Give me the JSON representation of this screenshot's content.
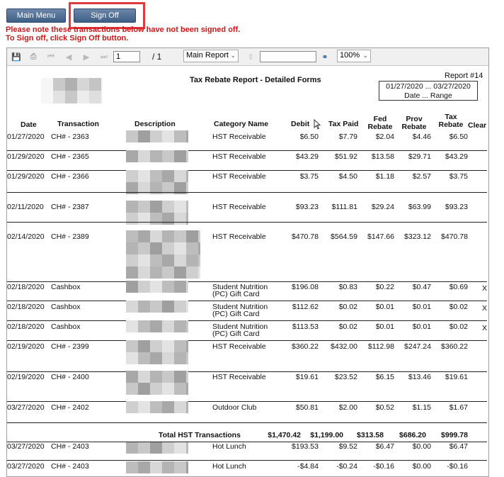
{
  "buttons": {
    "main_menu": "Main Menu",
    "sign_off": "Sign Off"
  },
  "notice": {
    "line1": "Please note these transactions below have not been signed off.",
    "line2": "To Sign off, click Sign Off button."
  },
  "toolbar": {
    "page_current": "1",
    "page_total": "/ 1",
    "report_select": "Main Report",
    "search_value": "",
    "zoom": "100%"
  },
  "report": {
    "title": "Tax Rebate Report - Detailed Forms",
    "report_no": "Report #14",
    "date_range": "01/27/2020 ... 03/27/2020",
    "date_range_label": "Date ... Range",
    "headers": {
      "date": "Date",
      "transaction": "Transaction",
      "description": "Description",
      "category": "Category Name",
      "debit": "Debit",
      "tax_paid": "Tax Paid",
      "fed_rebate": "Fed Rebate",
      "prov_rebate": "Prov Rebate",
      "tax_rebate": "Tax Rebate",
      "clear": "Clear"
    },
    "rows": [
      {
        "date": "01/27/2020",
        "txn": "CH# - 2363",
        "cat": "HST Receivable",
        "cat2": "",
        "debit": "$6.50",
        "tax_paid": "$7.79",
        "fed": "$2.04",
        "prov": "$4.46",
        "rebate": "$6.50",
        "clear": ""
      },
      {
        "date": "01/29/2020",
        "txn": "CH# - 2365",
        "cat": "HST Receivable",
        "cat2": "",
        "debit": "$43.29",
        "tax_paid": "$51.92",
        "fed": "$13.58",
        "prov": "$29.71",
        "rebate": "$43.29",
        "clear": ""
      },
      {
        "date": "01/29/2020",
        "txn": "CH# - 2366",
        "cat": "HST Receivable",
        "cat2": "",
        "debit": "$3.75",
        "tax_paid": "$4.50",
        "fed": "$1.18",
        "prov": "$2.57",
        "rebate": "$3.75",
        "clear": ""
      },
      {
        "date": "02/11/2020",
        "txn": "CH# - 2387",
        "cat": "HST Receivable",
        "cat2": "",
        "debit": "$93.23",
        "tax_paid": "$111.81",
        "fed": "$29.24",
        "prov": "$63.99",
        "rebate": "$93.23",
        "clear": ""
      },
      {
        "date": "02/14/2020",
        "txn": "CH# - 2389",
        "cat": "HST Receivable",
        "cat2": "",
        "debit": "$470.78",
        "tax_paid": "$564.59",
        "fed": "$147.66",
        "prov": "$323.12",
        "rebate": "$470.78",
        "clear": ""
      },
      {
        "date": "02/18/2020",
        "txn": "Cashbox",
        "cat": "Student Nutrition",
        "cat2": "(PC) Gift Card",
        "debit": "$196.08",
        "tax_paid": "$0.83",
        "fed": "$0.22",
        "prov": "$0.47",
        "rebate": "$0.69",
        "clear": "X"
      },
      {
        "date": "02/18/2020",
        "txn": "Cashbox",
        "cat": "Student Nutrition",
        "cat2": "(PC) Gift Card",
        "debit": "$112.62",
        "tax_paid": "$0.02",
        "fed": "$0.01",
        "prov": "$0.01",
        "rebate": "$0.02",
        "clear": "X"
      },
      {
        "date": "02/18/2020",
        "txn": "Cashbox",
        "cat": "Student Nutrition",
        "cat2": "(PC) Gift Card",
        "debit": "$113.53",
        "tax_paid": "$0.02",
        "fed": "$0.01",
        "prov": "$0.01",
        "rebate": "$0.02",
        "clear": "X"
      },
      {
        "date": "02/19/2020",
        "txn": "CH# - 2399",
        "cat": "HST Receivable",
        "cat2": "",
        "debit": "$360.22",
        "tax_paid": "$432.00",
        "fed": "$112.98",
        "prov": "$247.24",
        "rebate": "$360.22",
        "clear": ""
      },
      {
        "date": "02/19/2020",
        "txn": "CH# - 2400",
        "cat": "HST Receivable",
        "cat2": "",
        "debit": "$19.61",
        "tax_paid": "$23.52",
        "fed": "$6.15",
        "prov": "$13.46",
        "rebate": "$19.61",
        "clear": ""
      },
      {
        "date": "03/27/2020",
        "txn": "CH# - 2402",
        "cat": "Outdoor Club",
        "cat2": "",
        "debit": "$50.81",
        "tax_paid": "$2.00",
        "fed": "$0.52",
        "prov": "$1.15",
        "rebate": "$1.67",
        "clear": ""
      }
    ],
    "total": {
      "label": "Total HST Transactions",
      "debit": "$1,470.42",
      "tax_paid": "$1,199.00",
      "fed": "$313.58",
      "prov": "$686.20",
      "rebate": "$999.78"
    },
    "rows2": [
      {
        "date": "03/27/2020",
        "txn": "CH# - 2403",
        "cat": "Hot Lunch",
        "debit": "$193.53",
        "tax_paid": "$9.52",
        "fed": "$6.47",
        "prov": "$0.00",
        "rebate": "$6.47"
      },
      {
        "date": "03/27/2020",
        "txn": "CH# - 2403",
        "cat": "Hot Lunch",
        "debit": "-$4.84",
        "tax_paid": "-$0.24",
        "fed": "-$0.16",
        "prov": "$0.00",
        "rebate": "-$0.16"
      }
    ]
  }
}
